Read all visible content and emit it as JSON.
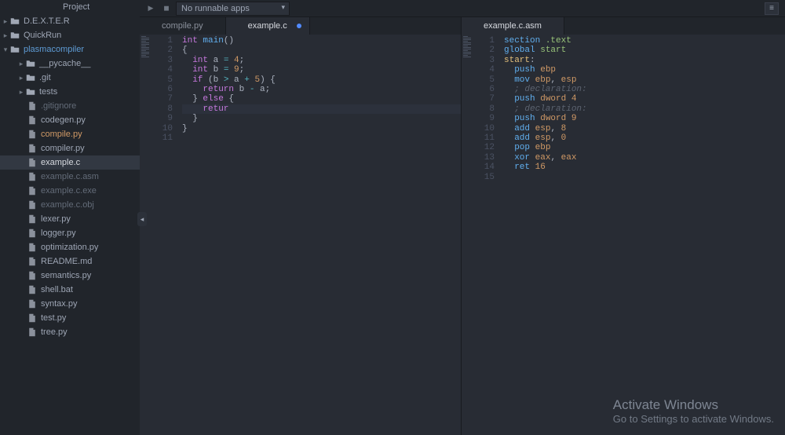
{
  "sidebar": {
    "header": "Project",
    "roots": [
      {
        "label": "D.E.X.T.E.R",
        "expanded": false
      },
      {
        "label": "QuickRun",
        "expanded": false
      },
      {
        "label": "plasmacompiler",
        "expanded": true
      }
    ],
    "folders": [
      {
        "label": "__pycache__",
        "depth": 1
      },
      {
        "label": ".git",
        "depth": 1
      },
      {
        "label": "tests",
        "depth": 1
      }
    ],
    "files": [
      {
        "label": ".gitignore",
        "dim": true
      },
      {
        "label": "codegen.py",
        "dim": false
      },
      {
        "label": "compile.py",
        "dim": false,
        "accent": true
      },
      {
        "label": "compiler.py",
        "dim": false
      },
      {
        "label": "example.c",
        "dim": false,
        "selected": true
      },
      {
        "label": "example.c.asm",
        "dim": true
      },
      {
        "label": "example.c.exe",
        "dim": true
      },
      {
        "label": "example.c.obj",
        "dim": true
      },
      {
        "label": "lexer.py",
        "dim": false
      },
      {
        "label": "logger.py",
        "dim": false
      },
      {
        "label": "optimization.py",
        "dim": false
      },
      {
        "label": "README.md",
        "dim": false
      },
      {
        "label": "semantics.py",
        "dim": false
      },
      {
        "label": "shell.bat",
        "dim": false
      },
      {
        "label": "syntax.py",
        "dim": false
      },
      {
        "label": "test.py",
        "dim": false
      },
      {
        "label": "tree.py",
        "dim": false
      }
    ]
  },
  "toolbar": {
    "run_select": "No runnable apps"
  },
  "panes": {
    "left": {
      "tabs": [
        {
          "label": "compile.py",
          "active": false,
          "modified": false
        },
        {
          "label": "example.c",
          "active": true,
          "modified": true
        }
      ],
      "code": {
        "lines": [
          [
            [
              "int",
              "type"
            ],
            [
              " "
            ],
            [
              "main",
              "func"
            ],
            [
              "()",
              "punct"
            ]
          ],
          [
            [
              "{",
              "punct"
            ]
          ],
          [
            [
              "  "
            ],
            [
              "int",
              "type"
            ],
            [
              " a "
            ],
            [
              "=",
              "op"
            ],
            [
              " "
            ],
            [
              "4",
              "num"
            ],
            [
              ";",
              "punct"
            ]
          ],
          [
            [
              "  "
            ],
            [
              "int",
              "type"
            ],
            [
              " b "
            ],
            [
              "=",
              "op"
            ],
            [
              " "
            ],
            [
              "9",
              "num"
            ],
            [
              ";",
              "punct"
            ]
          ],
          [
            [
              "  "
            ],
            [
              "if",
              "kw"
            ],
            [
              " (b "
            ],
            [
              ">",
              "op"
            ],
            [
              " a "
            ],
            [
              "+",
              "op"
            ],
            [
              " "
            ],
            [
              "5",
              "num"
            ],
            [
              ") {",
              "punct"
            ]
          ],
          [
            [
              "    "
            ],
            [
              "return",
              "kw"
            ],
            [
              " b "
            ],
            [
              "-",
              "op"
            ],
            [
              " a;",
              "punct"
            ]
          ],
          [
            [
              "  } "
            ],
            [
              "else",
              "kw"
            ],
            [
              " {",
              "punct"
            ]
          ],
          [
            [
              "    "
            ],
            [
              "retur",
              "kw"
            ]
          ],
          [
            [
              "  }",
              "punct"
            ]
          ],
          [
            [
              "}",
              "punct"
            ]
          ],
          [
            [
              "",
              ""
            ]
          ]
        ],
        "highlight_line": 8
      }
    },
    "right": {
      "tabs": [
        {
          "label": "example.c.asm",
          "active": true,
          "modified": false
        }
      ],
      "code": {
        "lines": [
          [
            [
              "section",
              "section"
            ],
            [
              " "
            ],
            [
              ".text",
              "sectarg"
            ]
          ],
          [
            [
              "global",
              "section"
            ],
            [
              " "
            ],
            [
              "start",
              "sectarg"
            ]
          ],
          [
            [
              "start",
              "label"
            ],
            [
              ":",
              "punct"
            ]
          ],
          [
            [
              "  "
            ],
            [
              "push",
              "instr"
            ],
            [
              " "
            ],
            [
              "ebp",
              "reg"
            ]
          ],
          [
            [
              "  "
            ],
            [
              "mov",
              "instr"
            ],
            [
              " "
            ],
            [
              "ebp",
              "reg"
            ],
            [
              ", "
            ],
            [
              "esp",
              "reg"
            ]
          ],
          [
            [
              "  "
            ],
            [
              "; declaration:",
              "cmt"
            ]
          ],
          [
            [
              "  "
            ],
            [
              "push",
              "instr"
            ],
            [
              " "
            ],
            [
              "dword",
              "reg"
            ],
            [
              " "
            ],
            [
              "4",
              "num"
            ]
          ],
          [
            [
              "  "
            ],
            [
              "; declaration:",
              "cmt"
            ]
          ],
          [
            [
              "  "
            ],
            [
              "push",
              "instr"
            ],
            [
              " "
            ],
            [
              "dword",
              "reg"
            ],
            [
              " "
            ],
            [
              "9",
              "num"
            ]
          ],
          [
            [
              "  "
            ],
            [
              "add",
              "instr"
            ],
            [
              " "
            ],
            [
              "esp",
              "reg"
            ],
            [
              ", "
            ],
            [
              "8",
              "num"
            ]
          ],
          [
            [
              "  "
            ],
            [
              "add",
              "instr"
            ],
            [
              " "
            ],
            [
              "esp",
              "reg"
            ],
            [
              ", "
            ],
            [
              "0",
              "num"
            ]
          ],
          [
            [
              "  "
            ],
            [
              "pop",
              "instr"
            ],
            [
              " "
            ],
            [
              "ebp",
              "reg"
            ]
          ],
          [
            [
              "  "
            ],
            [
              "xor",
              "instr"
            ],
            [
              " "
            ],
            [
              "eax",
              "reg"
            ],
            [
              ", "
            ],
            [
              "eax",
              "reg"
            ]
          ],
          [
            [
              "  "
            ],
            [
              "ret",
              "instr"
            ],
            [
              " "
            ],
            [
              "16",
              "num"
            ]
          ],
          [
            [
              "",
              ""
            ]
          ]
        ],
        "highlight_line": -1
      }
    }
  },
  "watermark": {
    "line1": "Activate Windows",
    "line2": "Go to Settings to activate Windows."
  }
}
